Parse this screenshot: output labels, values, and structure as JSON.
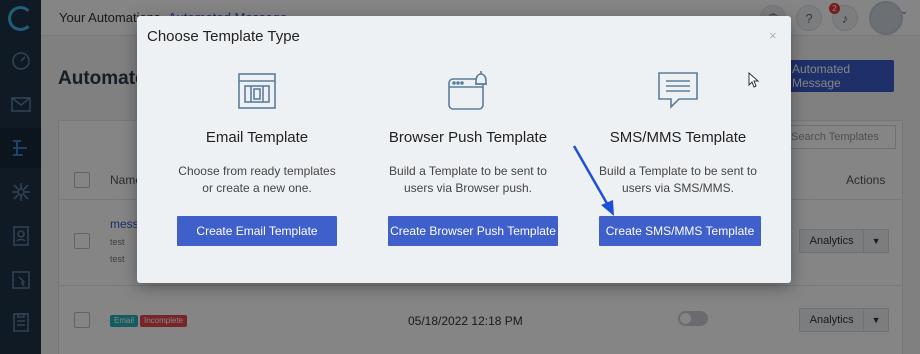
{
  "topbar": {
    "breadcrumb": [
      "Your Automations",
      "Automated Message"
    ],
    "notification_count": "2"
  },
  "page": {
    "title": "Automated Message",
    "new_button": "Automated Message",
    "search_placeholder": "Search Templates"
  },
  "table": {
    "headers": {
      "name": "Name",
      "actions": "Actions"
    },
    "rows": [
      {
        "name": "mess",
        "folder": "test",
        "tag": "test",
        "action": "Analytics"
      },
      {
        "badges": [
          "Email",
          "Incomplete"
        ],
        "date": "05/18/2022 12:18 PM",
        "action": "Analytics"
      }
    ]
  },
  "modal": {
    "title": "Choose Template Type",
    "close_icon": "×",
    "options": [
      {
        "icon": "email-template-icon",
        "title": "Email Template",
        "description_line1": "Choose from ready templates",
        "description_line2": "or create a new one.",
        "button": "Create Email Template"
      },
      {
        "icon": "browser-push-icon",
        "title": "Browser Push Template",
        "description_line1": "Build a Template to be sent to",
        "description_line2": "users via Browser push.",
        "button": "Create Browser Push Template"
      },
      {
        "icon": "sms-chat-icon",
        "title": "SMS/MMS Template",
        "description_line1": "Build a Template to be sent to",
        "description_line2": "users via SMS/MMS.",
        "button": "Create SMS/MMS Template"
      }
    ]
  },
  "colors": {
    "accent": "#3f5fcb",
    "sidebar": "#1f3346",
    "icon_blue": "#5b7d9c",
    "annotation_arrow": "#1f4fd6"
  }
}
